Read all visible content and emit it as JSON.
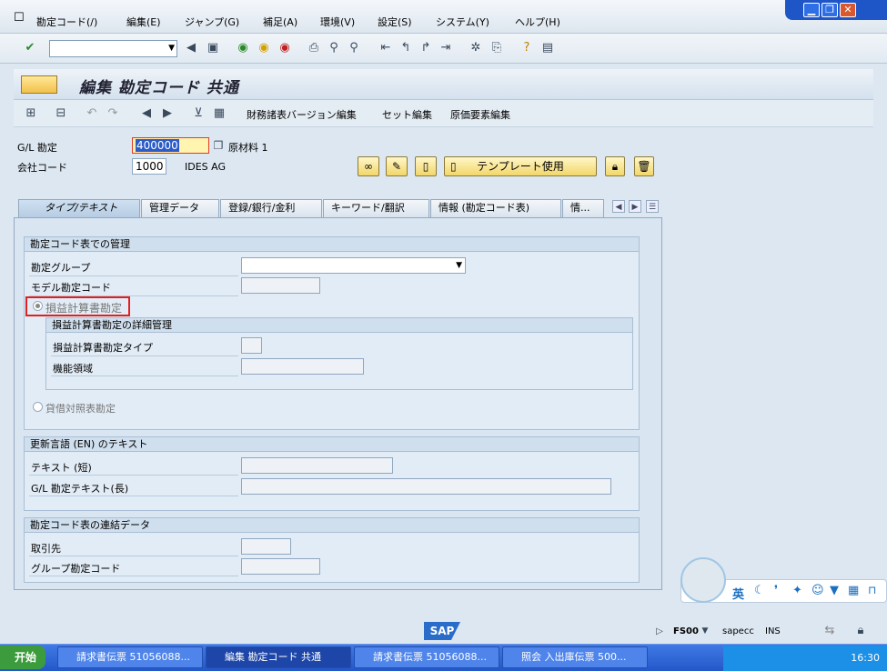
{
  "menubar": {
    "items": [
      "勘定コード(/)",
      "編集(E)",
      "ジャンプ(G)",
      "補足(A)",
      "環境(V)",
      "設定(S)",
      "システム(Y)",
      "ヘルプ(H)"
    ]
  },
  "title": "編集 勘定コード 共通",
  "app_toolbar": {
    "items": [
      "財務諸表バージョン編集",
      "セット編集",
      "原価要素編集"
    ]
  },
  "header_fields": {
    "gl_account_label": "G/L 勘定",
    "gl_account_value": "400000",
    "gl_account_desc": "原材料 1",
    "company_code_label": "会社コード",
    "company_code_value": "1000",
    "company_code_desc": "IDES AG",
    "template_button": "テンプレート使用"
  },
  "tabs": [
    "タイプ/テキスト",
    "管理データ",
    "登録/銀行/金利",
    "キーワード/翻訳",
    "情報 (勘定コード表)",
    "情..."
  ],
  "group_chart_mgmt": {
    "title": "勘定コード表での管理",
    "account_group_label": "勘定グループ",
    "sample_account_label": "モデル勘定コード",
    "pl_radio_label": "損益計算書勘定",
    "pl_detail_title": "損益計算書勘定の詳細管理",
    "pl_type_label": "損益計算書勘定タイプ",
    "functional_area_label": "機能領域",
    "bs_radio_label": "貸借対照表勘定"
  },
  "group_texts": {
    "title": "更新言語 (EN) のテキスト",
    "short_text_label": "テキスト (短)",
    "long_text_label": "G/L 勘定テキスト(長)"
  },
  "group_consolidation": {
    "title": "勘定コード表の連結データ",
    "trading_partner_label": "取引先",
    "group_account_label": "グループ勘定コード"
  },
  "status": {
    "logo": "SAP",
    "tcode": "FS00",
    "server": "sapecc",
    "mode": "INS"
  },
  "ime": {
    "lang": "英"
  },
  "taskbar": {
    "start": "开始",
    "tasks": [
      "請求書伝票 51056088...",
      "編集 勘定コード 共通",
      "請求書伝票 51056088...",
      "照会 入出庫伝票 500..."
    ],
    "clock": "16:30"
  }
}
